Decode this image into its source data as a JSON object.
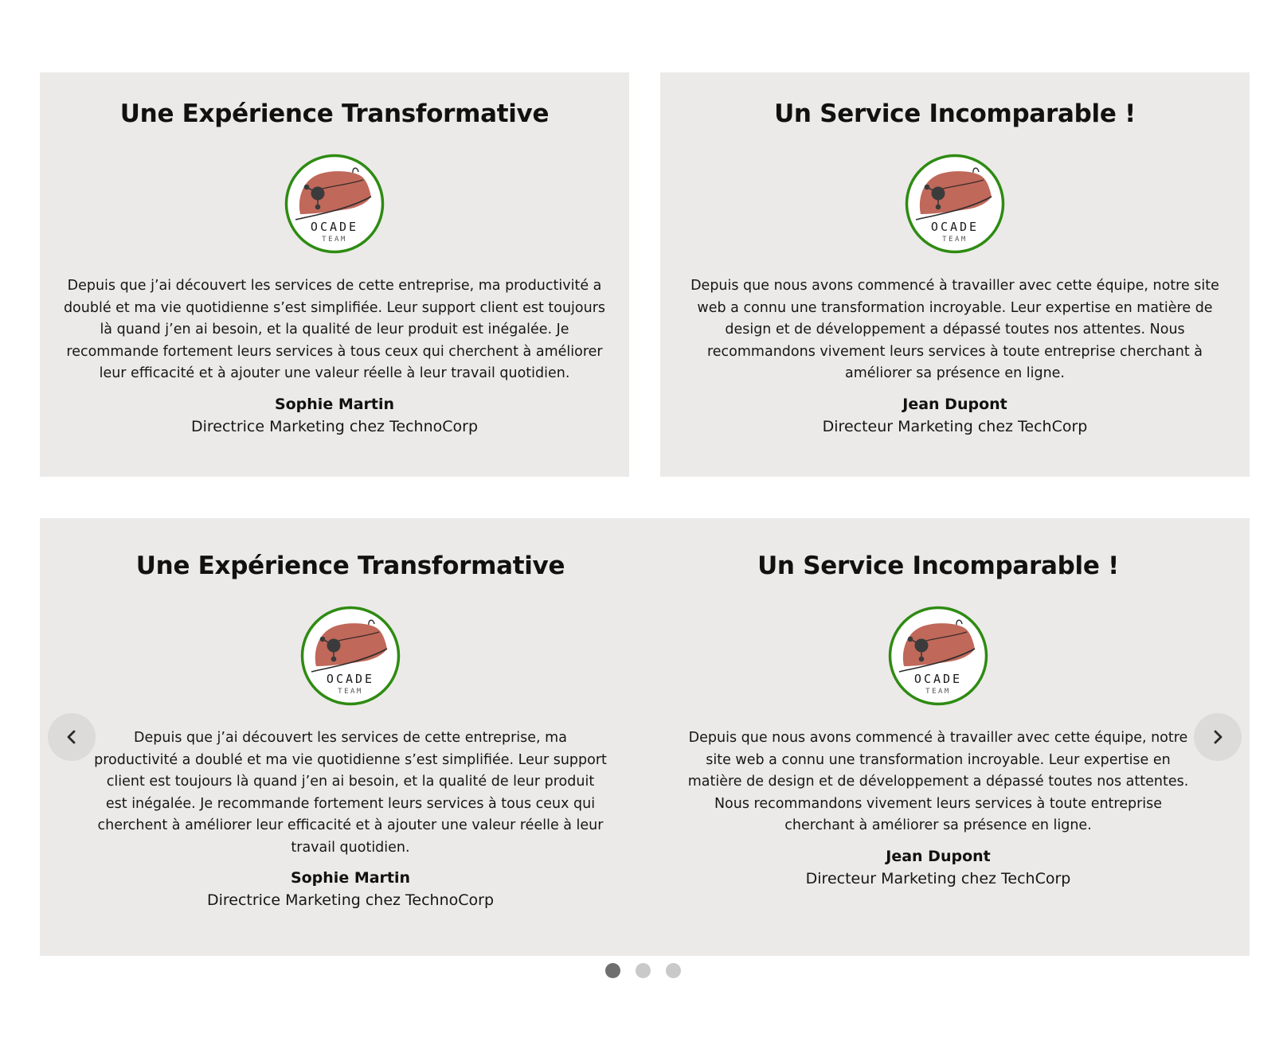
{
  "cards_top": [
    {
      "title": "Une Expérience Transformative",
      "logo": {
        "name": "OCADE",
        "sub": "TEAM"
      },
      "quote": "Depuis que j’ai découvert les services de cette entreprise, ma productivité a doublé et ma vie quotidienne s’est simplifiée. Leur support client est toujours là quand j’en ai besoin, et la qualité de leur produit est inégalée. Je recommande fortement leurs services à tous ceux qui cherchent à améliorer leur efficacité et à ajouter une valeur réelle à leur travail quotidien.",
      "author": "Sophie Martin",
      "role": "Directrice Marketing chez TechnoCorp"
    },
    {
      "title": "Un Service Incomparable !",
      "logo": {
        "name": "OCADE",
        "sub": "TEAM"
      },
      "quote": "Depuis que nous avons commencé à travailler avec cette équipe, notre site web a connu une transformation incroyable. Leur expertise en matière de design et de développement a dépassé toutes nos attentes. Nous recommandons vivement leurs services à toute entreprise cherchant à améliorer sa présence en ligne.",
      "author": "Jean Dupont",
      "role": "Directeur Marketing chez TechCorp"
    }
  ],
  "carousel": {
    "slides": [
      {
        "title": "Une Expérience Transformative",
        "logo": {
          "name": "OCADE",
          "sub": "TEAM"
        },
        "quote": "Depuis que j’ai découvert les services de cette entreprise, ma productivité a doublé et ma vie quotidienne s’est simplifiée. Leur support client est toujours là quand j’en ai besoin, et la qualité de leur produit est inégalée. Je recommande fortement leurs services à tous ceux qui cherchent à améliorer leur efficacité et à ajouter une valeur réelle à leur travail quotidien.",
        "author": "Sophie Martin",
        "role": "Directrice Marketing chez TechnoCorp"
      },
      {
        "title": "Un Service Incomparable !",
        "logo": {
          "name": "OCADE",
          "sub": "TEAM"
        },
        "quote": "Depuis que nous avons commencé à travailler avec cette équipe, notre site web a connu une transformation incroyable. Leur expertise en matière de design et de développement a dépassé toutes nos attentes. Nous recommandons vivement leurs services à toute entreprise cherchant à améliorer sa présence en ligne.",
        "author": "Jean Dupont",
        "role": "Directeur Marketing chez TechCorp"
      }
    ],
    "prev_icon": "chevron-left-icon",
    "next_icon": "chevron-right-icon",
    "dots": [
      {
        "active": true
      },
      {
        "active": false
      },
      {
        "active": false
      }
    ]
  },
  "colors": {
    "card_bg": "#ebeae8",
    "logo_ring": "#2e8b12",
    "helmet": "#c0685a",
    "dot_active": "#6f6f6f",
    "dot_inactive": "#c9c9c9"
  }
}
